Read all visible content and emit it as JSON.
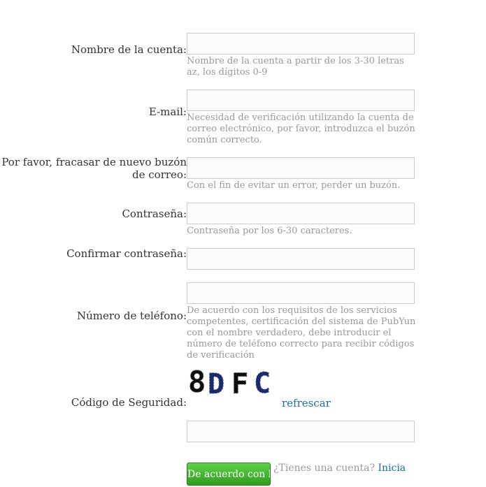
{
  "form": {
    "account_name": {
      "label": "Nombre de la cuenta:",
      "hint": "Nombre de la cuenta a partir de los 3-30 letras az, los dígitos 0-9",
      "value": ""
    },
    "email": {
      "label": "E-mail:",
      "hint": "Necesidad de verificación utilizando la cuenta de correo electrónico, por favor, introduzca el buzón común correcto.",
      "value": ""
    },
    "email_confirm": {
      "label": "Por favor, fracasar de nuevo buzón de correo:",
      "hint": "Con el fin de evitar un error, perder un buzón.",
      "value": ""
    },
    "password": {
      "label": "Contraseña:",
      "hint": "Contraseña por los 6-30 caracteres.",
      "value": ""
    },
    "password_confirm": {
      "label": "Confirmar contraseña:",
      "value": ""
    },
    "phone": {
      "label": "Número de teléfono:",
      "hint": "De acuerdo con los requisitos de los servicios competentes, certificación del sistema de PubYun con el nombre verdadero, debe introducir el número de teléfono correcto para recibir códigos de verificación",
      "value": ""
    },
    "security_code": {
      "label": "Código de Seguridad:",
      "captcha_text": "8DFC",
      "refresh_label": "refrescar",
      "value": ""
    },
    "submit_label": "De acuerdo con los",
    "have_account_text": "¿Tienes una cuenta?",
    "login_link": "Inicia"
  },
  "colors": {
    "label": "#333333",
    "hint": "#999999",
    "link": "#1a6fa3",
    "button_top": "#5fd14a",
    "button_bottom": "#2f9d1f",
    "captcha_dark": "#1b2a6b",
    "captcha_black": "#111111"
  }
}
